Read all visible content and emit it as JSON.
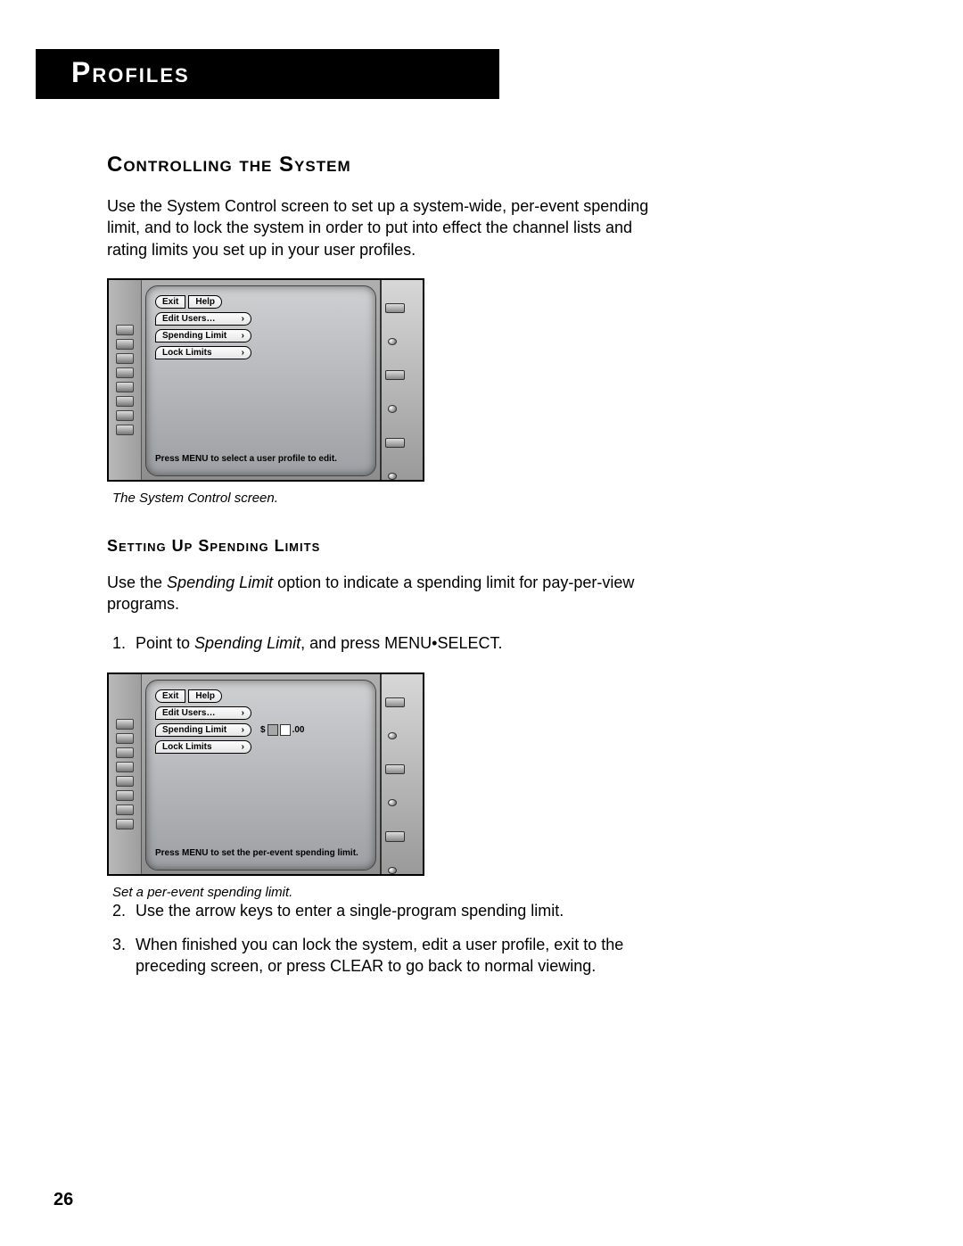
{
  "header": {
    "title": "Profiles"
  },
  "section": {
    "heading": "Controlling the System",
    "intro": "Use the System Control screen to set up a system-wide, per-event spending limit, and to lock the system in order to put  into effect the channel lists and rating limits you set up in your user profiles.",
    "caption1": "The System Control screen.",
    "subheading": "Setting Up Spending Limits",
    "sub_intro_pre": "Use the ",
    "sub_intro_em": "Spending Limit",
    "sub_intro_post": " option to indicate a spending limit for pay-per-view programs.",
    "step1_pre": "Point to ",
    "step1_em": "Spending Limit",
    "step1_post": ", and press MENU•SELECT.",
    "caption2": "Set a per-event spending limit.",
    "step2": "Use the arrow keys to enter a single-program spending limit.",
    "step3": "When finished you can lock the system, edit a user profile, exit to the preceding screen, or press CLEAR to go back to normal viewing."
  },
  "tv": {
    "exit": "Exit",
    "help": "Help",
    "edit_users": "Edit Users…",
    "spending_limit": "Spending Limit",
    "lock_limits": "Lock Limits",
    "hint1": "Press MENU to select a user profile to edit.",
    "hint2": "Press MENU to set the per-event spending limit.",
    "currency": "$",
    "cents": ".00"
  },
  "page_number": "26"
}
